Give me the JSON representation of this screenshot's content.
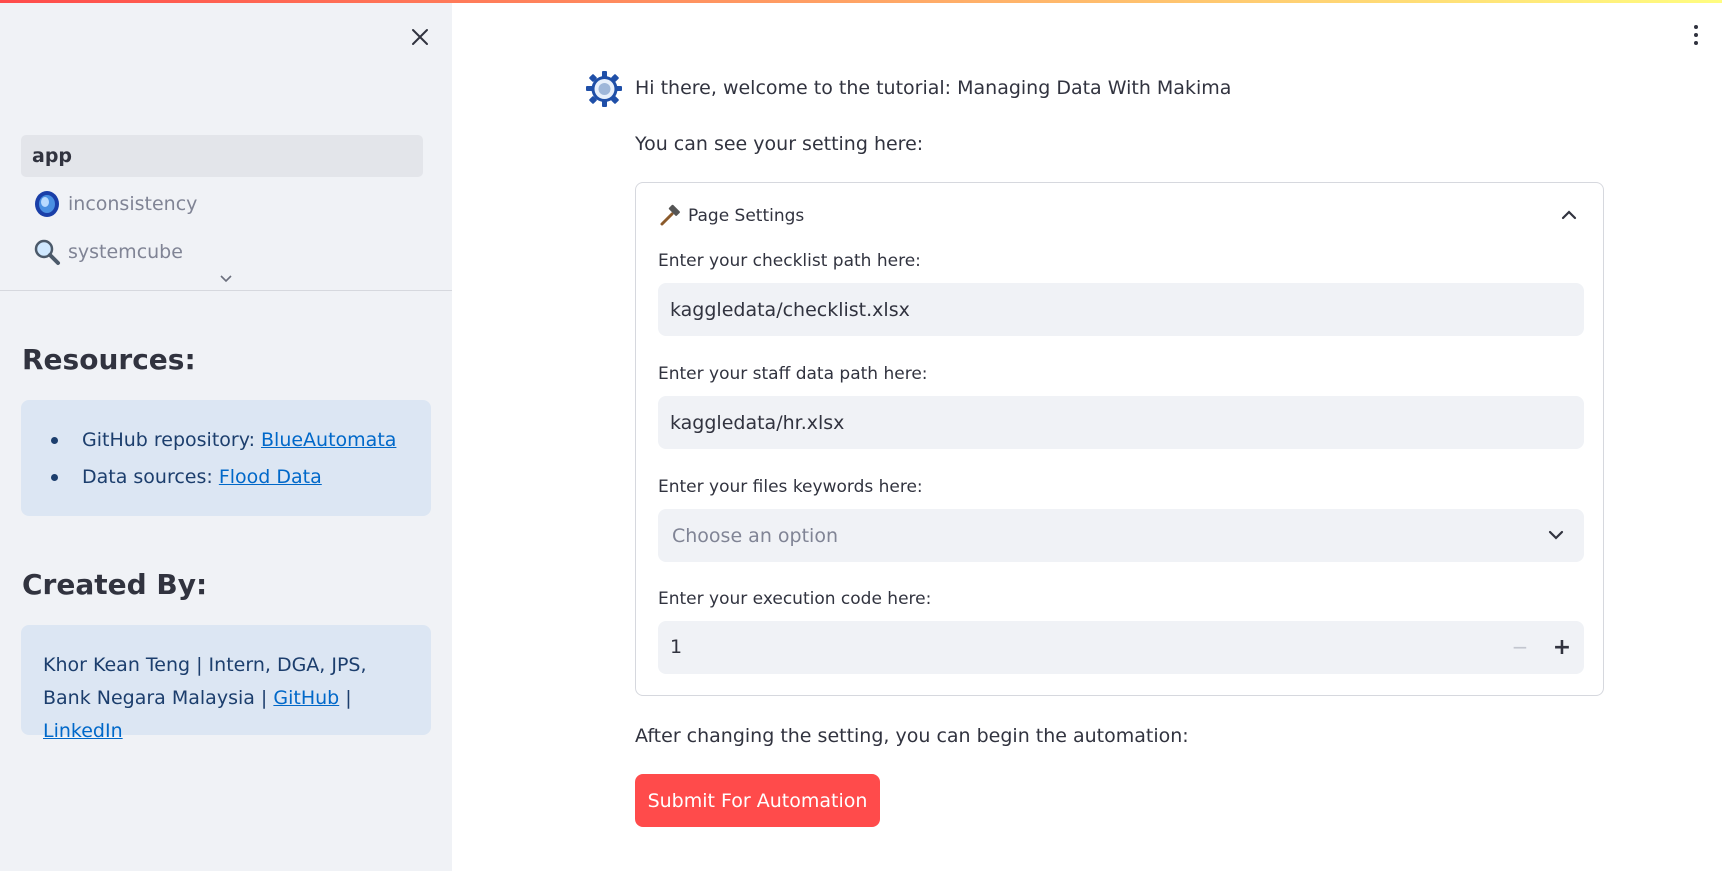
{
  "sidebar": {
    "close_icon": "close-icon",
    "nav": [
      {
        "label": "app",
        "icon": "none",
        "active": true
      },
      {
        "label": "inconsistency",
        "icon": "blue-orb-icon",
        "active": false
      },
      {
        "label": "systemcube",
        "icon": "magnifier-icon",
        "active": false
      }
    ],
    "resources_heading": "Resources:",
    "resources": [
      {
        "prefix": "GitHub repository: ",
        "link": "BlueAutomata"
      },
      {
        "prefix": "Data sources: ",
        "link": "Flood Data"
      }
    ],
    "created_heading": "Created By:",
    "created": {
      "text": "Khor Kean Teng | Intern, DGA, JPS, Bank Negara Malaysia | ",
      "link1": "GitHub",
      "sep": " | ",
      "link2": "LinkedIn"
    }
  },
  "main": {
    "greeting": "Hi there, welcome to the tutorial: Managing Data With Makima",
    "settings_intro": "You can see your setting here:",
    "expander": {
      "title": "Page Settings",
      "icon": "hammer-icon",
      "fields": {
        "checklist_label": "Enter your checklist path here:",
        "checklist_value": "kaggledata/checklist.xlsx",
        "staff_label": "Enter your staff data path here:",
        "staff_value": "kaggledata/hr.xlsx",
        "keywords_label": "Enter your files keywords here:",
        "keywords_placeholder": "Choose an option",
        "code_label": "Enter your execution code here:",
        "code_value": "1",
        "minus": "−",
        "plus": "+"
      }
    },
    "after_text": "After changing the setting, you can begin the automation:",
    "submit_label": "Submit For Automation"
  },
  "colors": {
    "accent": "#ff4b4b",
    "sidebar_bg": "#f0f2f6",
    "info_bg": "#dce6f3",
    "link": "#0068c9"
  }
}
